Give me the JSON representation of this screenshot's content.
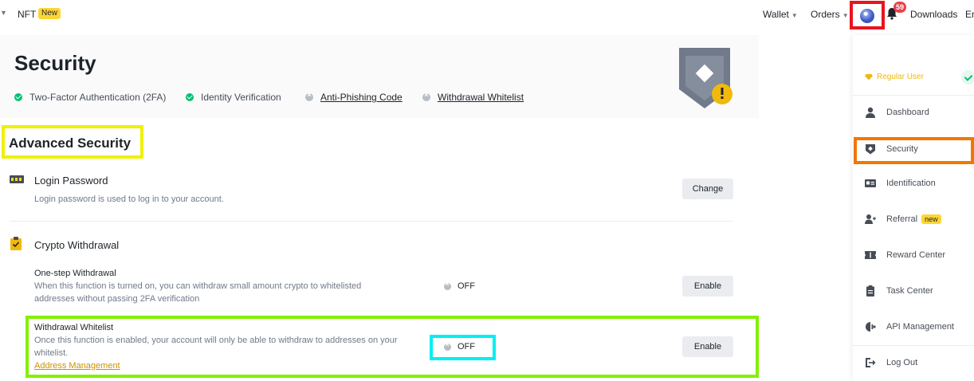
{
  "topbar": {
    "nft_label": "NFT",
    "nft_badge": "New",
    "wallet_label": "Wallet",
    "orders_label": "Orders",
    "notification_count": "59",
    "downloads_label": "Downloads",
    "language_label": "En"
  },
  "header": {
    "title": "Security",
    "statuses": [
      {
        "label": "Two-Factor Authentication (2FA)",
        "state": "enabled"
      },
      {
        "label": "Identity Verification",
        "state": "enabled"
      },
      {
        "label": "Anti-Phishing Code",
        "state": "disabled"
      },
      {
        "label": "Withdrawal Whitelist",
        "state": "disabled"
      }
    ]
  },
  "main": {
    "section_title": "Advanced Security",
    "login_password": {
      "title": "Login Password",
      "description": "Login password is used to log in to your account.",
      "button": "Change"
    },
    "crypto_withdrawal": {
      "title": "Crypto Withdrawal",
      "one_step": {
        "title": "One-step Withdrawal",
        "description_line1": "When this function is turned on, you can withdraw small amount crypto to whitelisted",
        "description_line2": "addresses without passing 2FA verification",
        "status": "OFF",
        "button": "Enable"
      },
      "whitelist": {
        "title": "Withdrawal Whitelist",
        "description_line1": "Once this function is enabled, your account will only be able to withdraw to addresses on your",
        "description_line2": "whitelist.",
        "link": "Address Management",
        "status": "OFF",
        "button": "Enable"
      }
    }
  },
  "menu": {
    "user_level": "Regular User",
    "items": [
      {
        "label": "Dashboard",
        "icon": "person-icon"
      },
      {
        "label": "Security",
        "icon": "shield-icon"
      },
      {
        "label": "Identification",
        "icon": "id-card-icon"
      },
      {
        "label": "Referral",
        "icon": "add-user-icon",
        "badge": "new"
      },
      {
        "label": "Reward Center",
        "icon": "ticket-icon"
      },
      {
        "label": "Task Center",
        "icon": "clipboard-icon"
      },
      {
        "label": "API Management",
        "icon": "api-icon"
      },
      {
        "label": "Log Out",
        "icon": "logout-icon"
      }
    ]
  },
  "colors": {
    "accent_yellow": "#fcd535",
    "success_green": "#02c076",
    "text_primary": "#1e2329",
    "text_secondary": "#707a8a",
    "link_gold": "#c99400",
    "annotation_red": "#e8141e",
    "annotation_yellow": "#f0f000",
    "annotation_green": "#84f000",
    "annotation_cyan": "#00f0f0",
    "annotation_orange": "#f07800"
  }
}
